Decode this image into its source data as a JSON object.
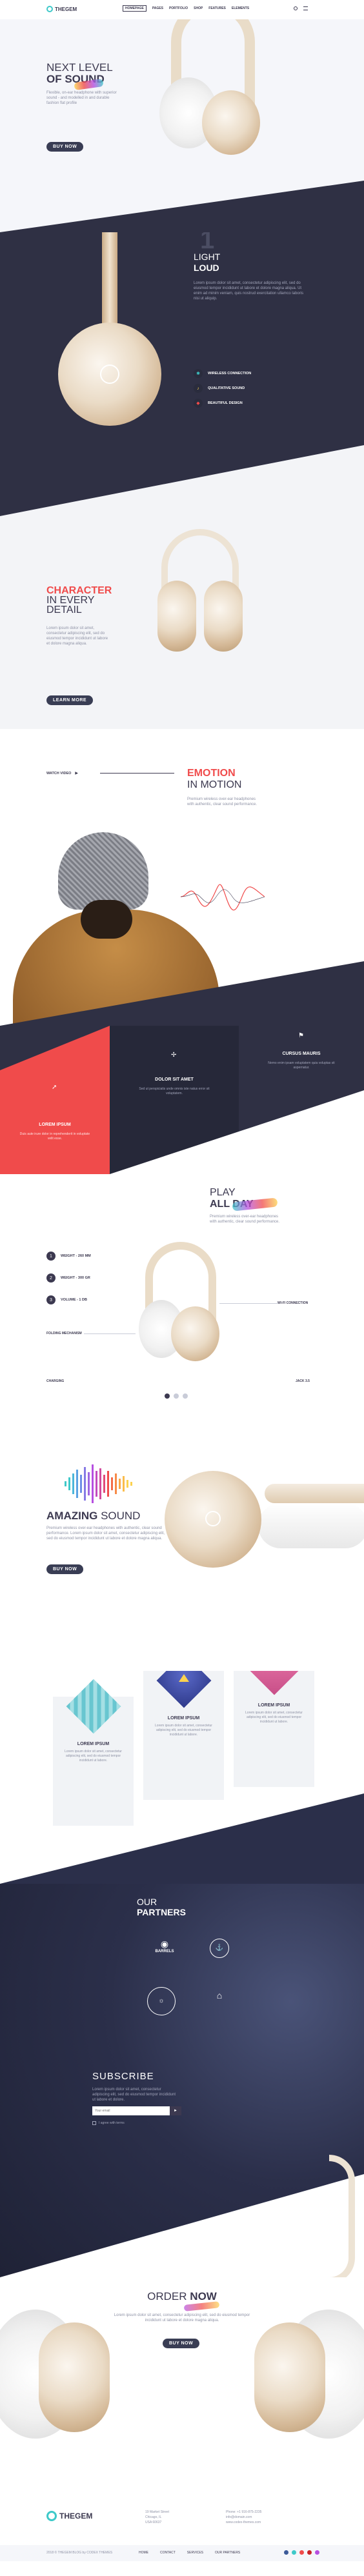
{
  "header": {
    "logo_text": "THEGEM",
    "nav": [
      "HOMEPAGE",
      "PAGES",
      "PORTFOLIO",
      "SHOP",
      "FEATURES",
      "ELEMENTS"
    ]
  },
  "hero": {
    "title_line1": "NEXT LEVEL",
    "title_line2": "OF SOUND",
    "text": "Flexible, on-ear headphone with superior sound - and modelled in and durable fashion flat profile",
    "button": "BUY NOW"
  },
  "light_loud": {
    "number": "1",
    "title_light": "LIGHT",
    "title_bold": "LOUD",
    "text": "Lorem ipsum dolor sit amet, consectetur adipiscing elit, sed do eiusmod tempor incididunt ut labore et dolore magna aliqua. Ut enim ad minim veniam, quis nostrud exercitation ullamco laboris nisi ut aliquip.",
    "features": [
      "WIRELESS CONNECTION",
      "QUALITATIVE SOUND",
      "BEAUTIFUL DESIGN"
    ]
  },
  "character": {
    "title_line1": "CHARACTER",
    "title_line2": "IN EVERY",
    "title_line3": "DETAIL",
    "text": "Lorem ipsum dolor sit amet, consectetur adipiscing elit, sed do eiusmod tempor incididunt ut labore et dolore magna aliqua.",
    "button": "LEARN MORE"
  },
  "emotion": {
    "watch_label": "WATCH VIDEO",
    "title_line1": "EMOTION",
    "title_line2": "IN MOTION",
    "text": "Premium wireless over-ear headphones with authentic, clear sound performance."
  },
  "tiles": [
    {
      "title": "LOREM IPSUM",
      "text": "Duis aute irure dolor in reprehenderit in voluptate velit esse."
    },
    {
      "title": "DOLOR SIT AMET",
      "text": "Sed ut perspiciatis unde omnis iste natus error sit voluptatem."
    },
    {
      "title": "CURSUS MAURIS",
      "text": "Nemo enim ipsam voluptatem quia voluptas sit aspernatur."
    }
  ],
  "play": {
    "title_line1": "PLAY",
    "title_line2": "ALL DAY",
    "text": "Premium wireless over-ear headphones with authentic, clear sound performance.",
    "specs": [
      {
        "num": "1",
        "label": "WEIGHT - 260 MM"
      },
      {
        "num": "2",
        "label": "WEIGHT - 300 GR"
      },
      {
        "num": "3",
        "label": "VOLUME - 1 DB"
      }
    ],
    "right_label": "WI-FI CONNECTION",
    "left_label": "FOLDING MECHANISM",
    "bottom_left": "CHARGING",
    "bottom_right": "JACK 3.5"
  },
  "amazing": {
    "title_bold": "AMAZING",
    "title_light": "SOUND",
    "text": "Premium wireless over-ear headphones with authentic, clear sound performance. Lorem ipsum dolor sit amet, consectetur adipiscing elit, sed do eiusmod tempor incididunt ut labore et dolore magna aliqua.",
    "button": "BUY NOW"
  },
  "cards": [
    {
      "title": "LOREM IPSUM",
      "text": "Lorem ipsum dolor sit amet, consectetur adipiscing elit, sed do eiusmod tempor incididunt ut labore."
    },
    {
      "title": "LOREM IPSUM",
      "text": "Lorem ipsum dolor sit amet, consectetur adipiscing elit, sed do eiusmod tempor incididunt ut labore."
    },
    {
      "title": "LOREM IPSUM",
      "text": "Lorem ipsum dolor sit amet, consectetur adipiscing elit, sed do eiusmod tempor incididunt ut labore."
    }
  ],
  "partners": {
    "title_line1": "OUR",
    "title_line2": "PARTNERS",
    "logos": [
      "BARRELS",
      "",
      "",
      ""
    ]
  },
  "subscribe": {
    "title": "SUBSCRIBE",
    "text": "Lorem ipsum dolor sit amet, consectetur adipiscing elit, sed do eiusmod tempor incididunt ut labore et dolore.",
    "placeholder": "Your email",
    "button": "►",
    "checkbox_label": "I agree with terms"
  },
  "order": {
    "title_light": "ORDER",
    "title_bold": "NOW",
    "text": "Lorem ipsum dolor sit amet, consectetur adipiscing elit, sed do eiusmod tempor incididunt ut labore et dolore magna aliqua.",
    "button": "BUY NOW"
  },
  "footer": {
    "logo_text": "THEGEM",
    "contact_left": [
      "19 Market Street",
      "Chicago, IL",
      "USA 60637"
    ],
    "contact_right": [
      "Phone: +1 916-875-2235",
      "info@domain.com",
      "www.codex-themes.com"
    ],
    "copyright": "2018 © THEGEM BLOG by CODEX THEMES",
    "links": [
      "HOME",
      "CONTACT",
      "SERVICES",
      "OUR PARTNERS"
    ]
  },
  "colors": {
    "accent": "#f04b4b",
    "dark": "#393d54",
    "teal": "#3ec9c9"
  }
}
